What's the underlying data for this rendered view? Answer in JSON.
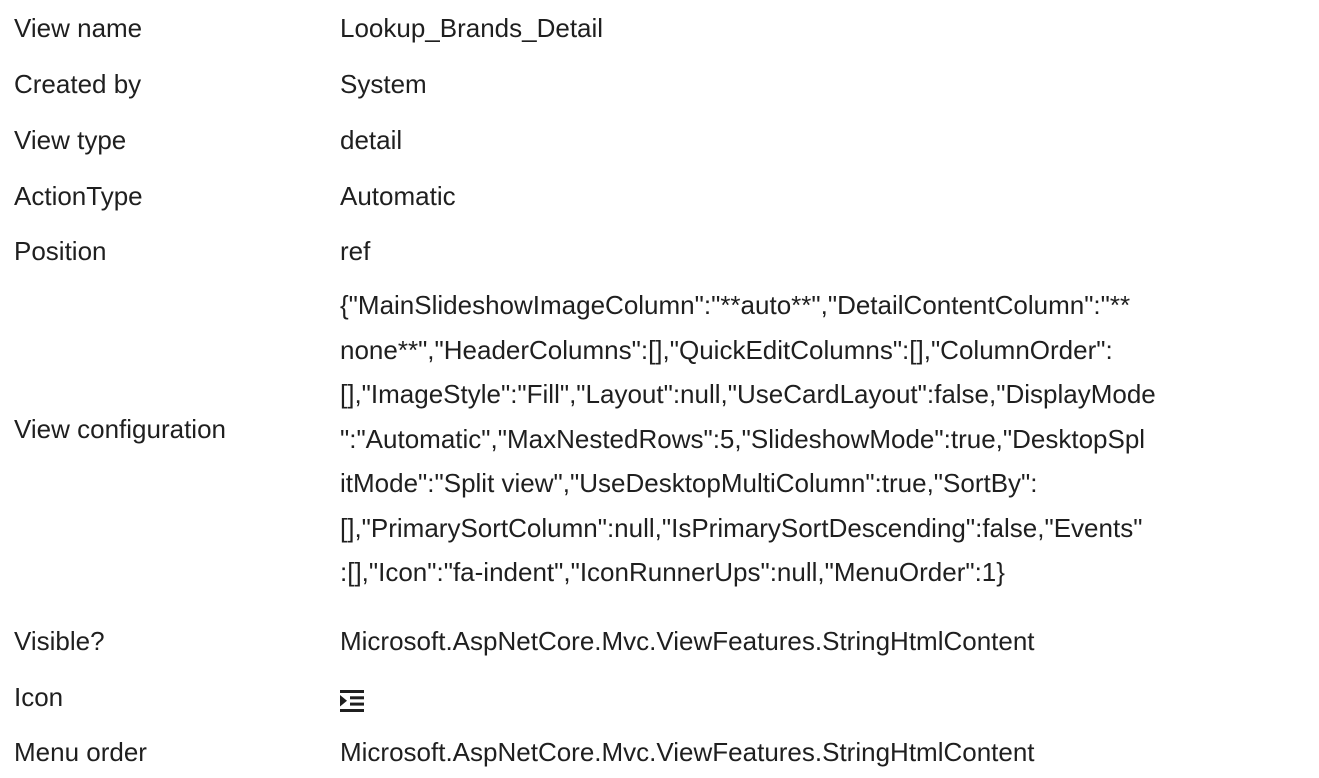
{
  "properties": {
    "view_name": {
      "label": "View name",
      "value": "Lookup_Brands_Detail"
    },
    "created_by": {
      "label": "Created by",
      "value": "System"
    },
    "view_type": {
      "label": "View type",
      "value": "detail"
    },
    "action_type": {
      "label": "ActionType",
      "value": "Automatic"
    },
    "position": {
      "label": "Position",
      "value": "ref"
    },
    "view_configuration": {
      "label": "View configuration",
      "value": "{\"MainSlideshowImageColumn\":\"**auto**\",\"DetailContentColumn\":\"**none**\",\"HeaderColumns\":[],\"QuickEditColumns\":[],\"ColumnOrder\":[],\"ImageStyle\":\"Fill\",\"Layout\":null,\"UseCardLayout\":false,\"DisplayMode\":\"Automatic\",\"MaxNestedRows\":5,\"SlideshowMode\":true,\"DesktopSplitMode\":\"Split view\",\"UseDesktopMultiColumn\":true,\"SortBy\":[],\"PrimarySortColumn\":null,\"IsPrimarySortDescending\":false,\"Events\":[],\"Icon\":\"fa-indent\",\"IconRunnerUps\":null,\"MenuOrder\":1}",
      "lines": [
        "{\"MainSlideshowImageColumn\":\"**auto**\",\"DetailContentColumn\":\"**",
        "none**\",\"HeaderColumns\":[],\"QuickEditColumns\":[],\"ColumnOrder\":",
        "[],\"ImageStyle\":\"Fill\",\"Layout\":null,\"UseCardLayout\":false,\"DisplayMode",
        "\":\"Automatic\",\"MaxNestedRows\":5,\"SlideshowMode\":true,\"DesktopSpl",
        "itMode\":\"Split view\",\"UseDesktopMultiColumn\":true,\"SortBy\":",
        "[],\"PrimarySortColumn\":null,\"IsPrimarySortDescending\":false,\"Events\"",
        ":[],\"Icon\":\"fa-indent\",\"IconRunnerUps\":null,\"MenuOrder\":1}"
      ]
    },
    "visible": {
      "label": "Visible?",
      "value": "Microsoft.AspNetCore.Mvc.ViewFeatures.StringHtmlContent"
    },
    "icon": {
      "label": "Icon",
      "icon_name": "indent-icon"
    },
    "menu_order": {
      "label": "Menu order",
      "value": "Microsoft.AspNetCore.Mvc.ViewFeatures.StringHtmlContent"
    }
  }
}
